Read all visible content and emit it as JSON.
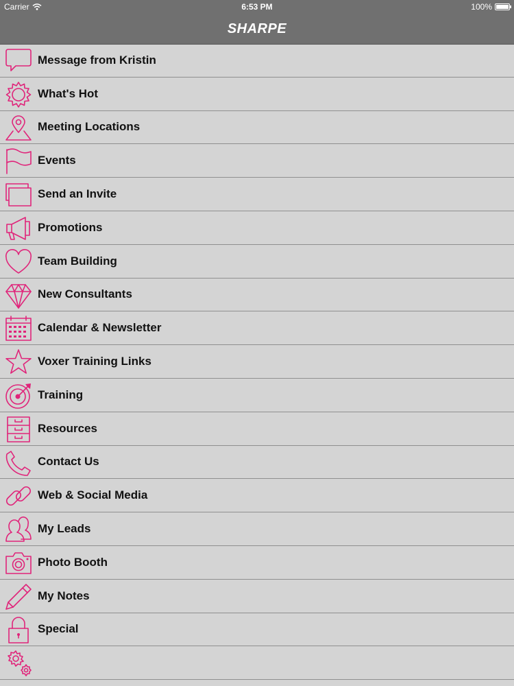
{
  "status_bar": {
    "carrier": "Carrier",
    "time": "6:53 PM",
    "battery": "100%"
  },
  "header": {
    "title": "SHARPE"
  },
  "accent_color": "#e0247a",
  "menu": {
    "items": [
      {
        "label": "Message from Kristin",
        "icon": "speech-bubble-icon"
      },
      {
        "label": "What's Hot",
        "icon": "sun-icon"
      },
      {
        "label": "Meeting Locations",
        "icon": "map-pin-icon"
      },
      {
        "label": "Events",
        "icon": "flag-icon"
      },
      {
        "label": "Send an Invite",
        "icon": "cards-icon"
      },
      {
        "label": "Promotions",
        "icon": "megaphone-icon"
      },
      {
        "label": "Team Building",
        "icon": "heart-icon"
      },
      {
        "label": "New Consultants",
        "icon": "diamond-icon"
      },
      {
        "label": "Calendar & Newsletter",
        "icon": "calendar-icon"
      },
      {
        "label": "Voxer Training Links",
        "icon": "star-icon"
      },
      {
        "label": "Training",
        "icon": "target-icon"
      },
      {
        "label": "Resources",
        "icon": "file-cabinet-icon"
      },
      {
        "label": "Contact Us",
        "icon": "phone-icon"
      },
      {
        "label": "Web & Social Media",
        "icon": "link-icon"
      },
      {
        "label": "My Leads",
        "icon": "people-icon"
      },
      {
        "label": "Photo Booth",
        "icon": "camera-icon"
      },
      {
        "label": "My Notes",
        "icon": "pencil-icon"
      },
      {
        "label": "Special",
        "icon": "lock-icon"
      },
      {
        "label": "",
        "icon": "gears-icon"
      }
    ]
  }
}
